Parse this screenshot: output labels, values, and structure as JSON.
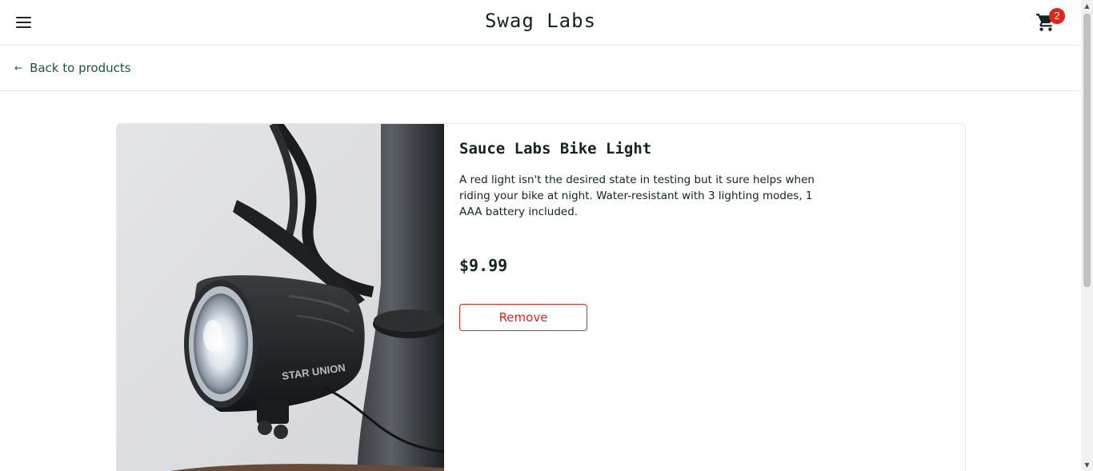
{
  "header": {
    "title": "Swag Labs",
    "cart_count": "2",
    "badge_color": "#e2231a"
  },
  "subbar": {
    "back_label": "Back to products"
  },
  "product": {
    "name": "Sauce Labs Bike Light",
    "description": "A red light isn't the desired state in testing but it sure helps when riding your bike at night. Water-resistant with 3 lighting modes, 1 AAA battery included.",
    "price": "$9.99",
    "remove_label": "Remove",
    "image_brand_text": "STAR UNION",
    "image_alt": "Sauce Labs Bike Light"
  },
  "theme": {
    "accent_green": "#18583a",
    "danger_red": "#e2231a",
    "text_dark": "#132322"
  }
}
